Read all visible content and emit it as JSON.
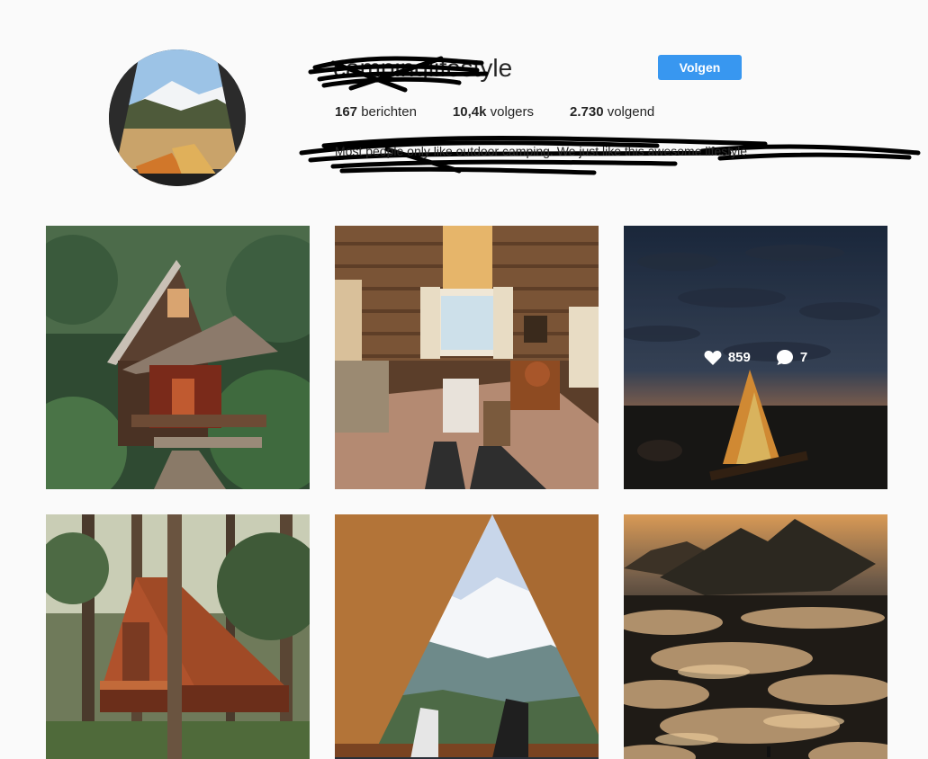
{
  "profile": {
    "username": "campinglifestyle",
    "follow_label": "Volgen",
    "bio": "Most people only like outdoor camping. We just like this awesome lifestyle"
  },
  "stats": [
    {
      "value": "167",
      "label": "berichten"
    },
    {
      "value": "10,4k",
      "label": "volgers"
    },
    {
      "value": "2.730",
      "label": "volgend"
    }
  ],
  "posts": [
    {
      "name": "post-cabin-forest"
    },
    {
      "name": "post-cabin-interior"
    },
    {
      "name": "post-campfire",
      "likes": "859",
      "comments": "7"
    },
    {
      "name": "post-a-frame-cabin"
    },
    {
      "name": "post-tent-mountain-view"
    },
    {
      "name": "post-mountain-clouds"
    }
  ],
  "colors": {
    "accent": "#3897f0",
    "background": "#fafafa"
  }
}
